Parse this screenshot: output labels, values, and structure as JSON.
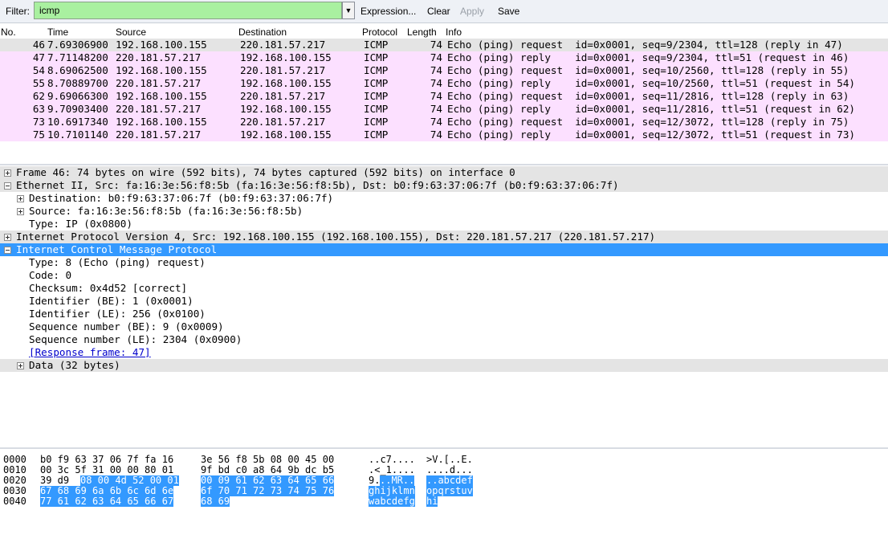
{
  "toolbar": {
    "filter_label": "Filter:",
    "filter_value": "icmp",
    "dropdown_glyph": "▼",
    "expression_label": "Expression...",
    "clear_label": "Clear",
    "apply_label": "Apply",
    "save_label": "Save",
    "filter_color": "#a9f0a0"
  },
  "packet_list": {
    "columns": [
      "No.",
      "Time",
      "Source",
      "Destination",
      "Protocol",
      "Length",
      "Info"
    ],
    "rows": [
      {
        "no": "46",
        "time": "7.69306900",
        "src": "192.168.100.155",
        "dst": "220.181.57.217",
        "proto": "ICMP",
        "len": "74",
        "info": "Echo (ping) request  id=0x0001, seq=9/2304, ttl=128 (reply in 47)",
        "bg": "#e4e4e4"
      },
      {
        "no": "47",
        "time": "7.71148200",
        "src": "220.181.57.217",
        "dst": "192.168.100.155",
        "proto": "ICMP",
        "len": "74",
        "info": "Echo (ping) reply    id=0x0001, seq=9/2304, ttl=51 (request in 46)",
        "bg": "#fce0ff"
      },
      {
        "no": "54",
        "time": "8.69062500",
        "src": "192.168.100.155",
        "dst": "220.181.57.217",
        "proto": "ICMP",
        "len": "74",
        "info": "Echo (ping) request  id=0x0001, seq=10/2560, ttl=128 (reply in 55)",
        "bg": "#fce0ff"
      },
      {
        "no": "55",
        "time": "8.70889700",
        "src": "220.181.57.217",
        "dst": "192.168.100.155",
        "proto": "ICMP",
        "len": "74",
        "info": "Echo (ping) reply    id=0x0001, seq=10/2560, ttl=51 (request in 54)",
        "bg": "#fce0ff"
      },
      {
        "no": "62",
        "time": "9.69066300",
        "src": "192.168.100.155",
        "dst": "220.181.57.217",
        "proto": "ICMP",
        "len": "74",
        "info": "Echo (ping) request  id=0x0001, seq=11/2816, ttl=128 (reply in 63)",
        "bg": "#fce0ff"
      },
      {
        "no": "63",
        "time": "9.70903400",
        "src": "220.181.57.217",
        "dst": "192.168.100.155",
        "proto": "ICMP",
        "len": "74",
        "info": "Echo (ping) reply    id=0x0001, seq=11/2816, ttl=51 (request in 62)",
        "bg": "#fce0ff"
      },
      {
        "no": "73",
        "time": "10.6917340",
        "src": "192.168.100.155",
        "dst": "220.181.57.217",
        "proto": "ICMP",
        "len": "74",
        "info": "Echo (ping) request  id=0x0001, seq=12/3072, ttl=128 (reply in 75)",
        "bg": "#fce0ff"
      },
      {
        "no": "75",
        "time": "10.7101140",
        "src": "220.181.57.217",
        "dst": "192.168.100.155",
        "proto": "ICMP",
        "len": "74",
        "info": "Echo (ping) reply    id=0x0001, seq=12/3072, ttl=51 (request in 73)",
        "bg": "#fce0ff"
      }
    ]
  },
  "details": {
    "frame": "Frame 46: 74 bytes on wire (592 bits), 74 bytes captured (592 bits) on interface 0",
    "ethernet": "Ethernet II, Src: fa:16:3e:56:f8:5b (fa:16:3e:56:f8:5b), Dst: b0:f9:63:37:06:7f (b0:f9:63:37:06:7f)",
    "eth_dst": "Destination: b0:f9:63:37:06:7f (b0:f9:63:37:06:7f)",
    "eth_src": "Source: fa:16:3e:56:f8:5b (fa:16:3e:56:f8:5b)",
    "eth_type": "Type: IP (0x0800)",
    "ip": "Internet Protocol Version 4, Src: 192.168.100.155 (192.168.100.155), Dst: 220.181.57.217 (220.181.57.217)",
    "icmp": "Internet Control Message Protocol",
    "icmp_type": "Type: 8 (Echo (ping) request)",
    "icmp_code": "Code: 0",
    "icmp_checksum": "Checksum: 0x4d52 [correct]",
    "icmp_id_be": "Identifier (BE): 1 (0x0001)",
    "icmp_id_le": "Identifier (LE): 256 (0x0100)",
    "icmp_seq_be": "Sequence number (BE): 9 (0x0009)",
    "icmp_seq_le": "Sequence number (LE): 2304 (0x0900)",
    "icmp_response": "[Response frame: 47]",
    "data": "Data (32 bytes)"
  },
  "bytes": {
    "r0": {
      "off": "0000",
      "h1": "b0 f9 63 37 06 7f fa 16",
      "h2": "3e 56 f8 5b 08 00 45 00",
      "a1": "..c7....",
      "a2": ">V.[..E."
    },
    "r1": {
      "off": "0010",
      "h1": "00 3c 5f 31 00 00 80 01",
      "h2": "9f bd c0 a8 64 9b dc b5",
      "a1": ".<_1....",
      "a2": "....d..."
    },
    "r2": {
      "off": "0020",
      "h1a": "39 d9",
      "h1b": "08 00 4d 52 00 01",
      "h2": "00 09 61 62 63 64 65 66",
      "a1a": "9.",
      "a1b": "..MR..",
      "a2": "..abcdef"
    },
    "r3": {
      "off": "0030",
      "h1": "67 68 69 6a 6b 6c 6d 6e",
      "h2": "6f 70 71 72 73 74 75 76",
      "a1": "ghijklmn",
      "a2": "opqrstuv"
    },
    "r4": {
      "off": "0040",
      "h1": "77 61 62 63 64 65 66 67",
      "h2": "68 69",
      "a1": "wabcdefg",
      "a2": "hi"
    }
  },
  "colors": {
    "selected": "#3399ff",
    "icmp_row": "#fce0ff",
    "selected_packet_row": "#e4e4e4"
  }
}
